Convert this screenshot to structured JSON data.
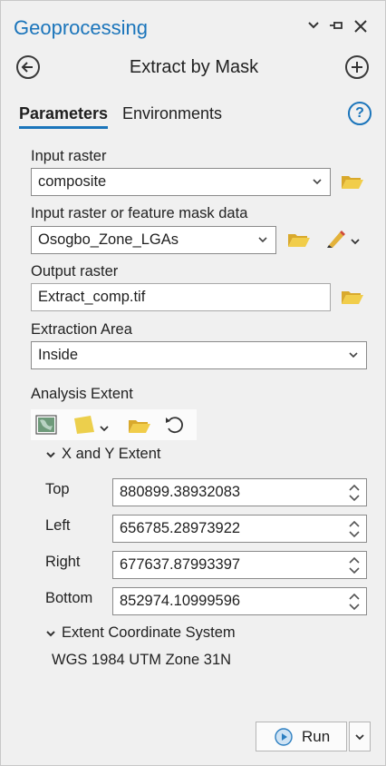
{
  "pane": {
    "title": "Geoprocessing",
    "tool_title": "Extract by Mask"
  },
  "tabs": [
    {
      "label": "Parameters",
      "active": true
    },
    {
      "label": "Environments",
      "active": false
    }
  ],
  "help_label": "?",
  "params": {
    "input_raster": {
      "label": "Input raster",
      "value": "composite"
    },
    "mask": {
      "label": "Input raster or feature mask data",
      "value": "Osogbo_Zone_LGAs"
    },
    "output": {
      "label": "Output raster",
      "value": "Extract_comp.tif"
    },
    "extraction_area": {
      "label": "Extraction Area",
      "value": "Inside"
    },
    "analysis_extent": {
      "label": "Analysis Extent"
    }
  },
  "extent": {
    "group_label": "X and Y Extent",
    "top": {
      "label": "Top",
      "value": "880899.38932083"
    },
    "left": {
      "label": "Left",
      "value": "656785.28973922"
    },
    "right": {
      "label": "Right",
      "value": "677637.87993397"
    },
    "bottom": {
      "label": "Bottom",
      "value": "852974.10999596"
    }
  },
  "coord_system": {
    "group_label": "Extent Coordinate System",
    "value": "WGS 1984 UTM Zone 31N"
  },
  "run_label": "Run",
  "colors": {
    "accent": "#1b75bb",
    "folder": "#e8c23c",
    "run_icon": "#2d7fc1"
  }
}
